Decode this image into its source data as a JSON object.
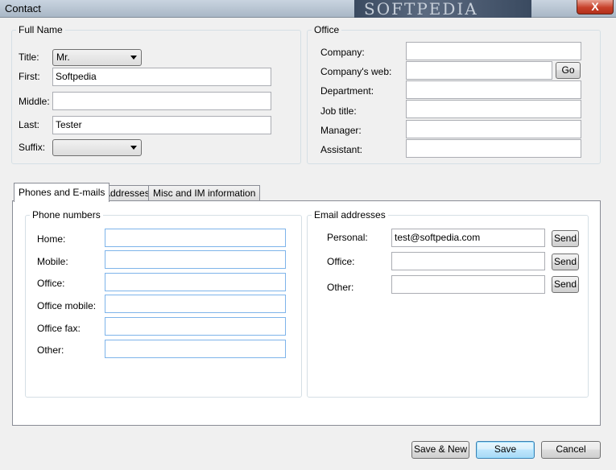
{
  "window": {
    "title": "Contact",
    "watermark": "SOFTPEDIA",
    "close_label": "X"
  },
  "full_name": {
    "legend": "Full Name",
    "title_label": "Title:",
    "title_value": "Mr.",
    "first_label": "First:",
    "first_value": "Softpedia",
    "middle_label": "Middle:",
    "middle_value": "",
    "last_label": "Last:",
    "last_value": "Tester",
    "suffix_label": "Suffix:",
    "suffix_value": ""
  },
  "office": {
    "legend": "Office",
    "company_label": "Company:",
    "company_value": "",
    "web_label": "Company's web:",
    "web_value": "",
    "go_label": "Go",
    "department_label": "Department:",
    "department_value": "",
    "jobtitle_label": "Job title:",
    "jobtitle_value": "",
    "manager_label": "Manager:",
    "manager_value": "",
    "assistant_label": "Assistant:",
    "assistant_value": ""
  },
  "tabs": [
    {
      "label": "Phones and E-mails",
      "active": true
    },
    {
      "label": "Addresses",
      "active": false
    },
    {
      "label": "Misc and IM information",
      "active": false
    }
  ],
  "phones": {
    "legend": "Phone numbers",
    "home_label": "Home:",
    "home_value": "",
    "mobile_label": "Mobile:",
    "mobile_value": "",
    "office_label": "Office:",
    "office_value": "",
    "office_mobile_label": "Office mobile:",
    "office_mobile_value": "",
    "office_fax_label": "Office fax:",
    "office_fax_value": "",
    "other_label": "Other:",
    "other_value": ""
  },
  "emails": {
    "legend": "Email addresses",
    "personal_label": "Personal:",
    "personal_value": "test@softpedia.com",
    "office_label": "Office:",
    "office_value": "",
    "other_label": "Other:",
    "other_value": "",
    "send_label": "Send"
  },
  "footer": {
    "save_new_label": "Save & New",
    "save_label": "Save",
    "cancel_label": "Cancel"
  }
}
